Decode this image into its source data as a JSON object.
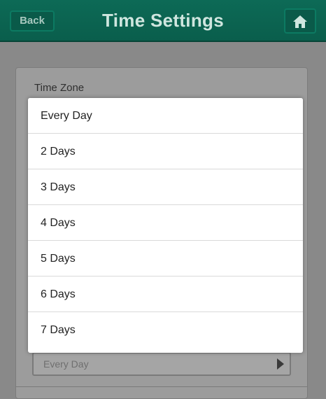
{
  "header": {
    "back_label": "Back",
    "title": "Time Settings",
    "home_icon": "home-icon",
    "color": "#0d6a56"
  },
  "panel": {
    "time_zone_label": "Time Zone",
    "selected_value": "Every Day"
  },
  "popup": {
    "options": [
      "Every Day",
      "2 Days",
      "3 Days",
      "4 Days",
      "5 Days",
      "6 Days",
      "7 Days"
    ]
  }
}
